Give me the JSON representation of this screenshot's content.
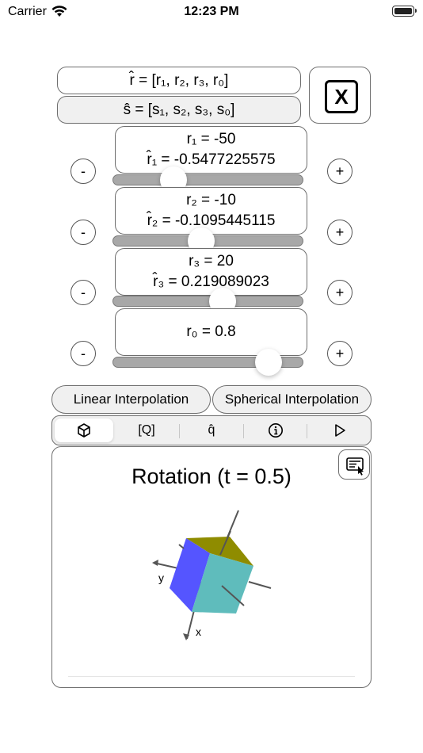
{
  "status_bar": {
    "carrier": "Carrier",
    "time": "12:23 PM"
  },
  "quaternion_r": "r̂ = [r₁, r₂, r₃, r₀]",
  "quaternion_s": "ŝ = [s₁, s₂, s₃, s₀]",
  "close_label": "X",
  "params": [
    {
      "value_label": "r₁ = -50",
      "normalized_label": "r̂₁ = -0.5477225575",
      "slider_fraction": 0.29
    },
    {
      "value_label": "r₂ = -10",
      "normalized_label": "r̂₂ = -0.1095445115",
      "slider_fraction": 0.46
    },
    {
      "value_label": "r₃ = 20",
      "normalized_label": "r̂₃ = 0.219089023",
      "slider_fraction": 0.59
    },
    {
      "value_label": "r₀ = 0.8",
      "normalized_label": "",
      "slider_fraction": 0.87
    }
  ],
  "minus_label": "-",
  "plus_label": "+",
  "interpolation": {
    "linear": "Linear Interpolation",
    "spherical": "Spherical Interpolation"
  },
  "tabs": [
    {
      "label": "",
      "icon": "cube-icon",
      "selected": true
    },
    {
      "label": "[Q]",
      "icon": ""
    },
    {
      "label": "q̂",
      "icon": ""
    },
    {
      "label": "",
      "icon": "info-icon"
    },
    {
      "label": "",
      "icon": "play-icon"
    }
  ],
  "visual": {
    "title": "Rotation (t = 0.5)",
    "axis_x": "x",
    "axis_y": "y",
    "colors": {
      "top_face": "#8f8c00",
      "left_face": "#5555ff",
      "front_face": "#5fbcbc"
    }
  }
}
